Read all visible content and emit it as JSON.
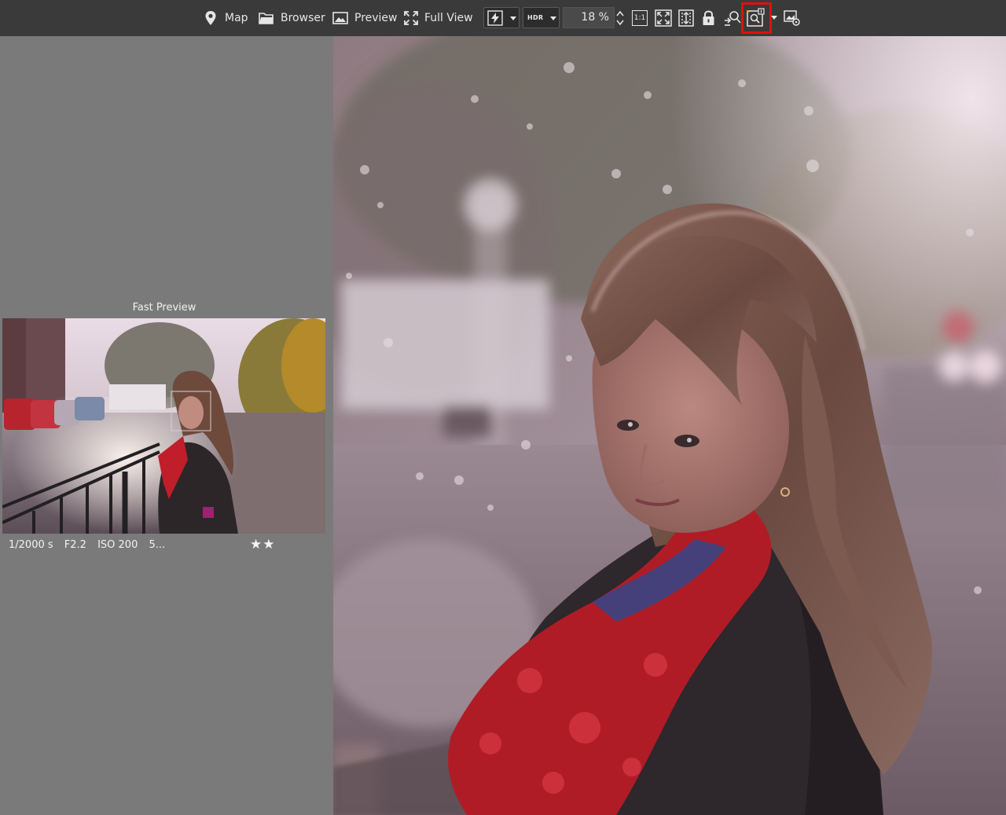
{
  "toolbar": {
    "map_label": "Map",
    "browser_label": "Browser",
    "preview_label": "Preview",
    "fullview_label": "Full View",
    "hdr_label": "HDR",
    "zoom_value": "18 %",
    "one_to_one_label": "1:1"
  },
  "left_panel": {
    "title": "Fast Preview",
    "exif": {
      "shutter": "1/2000 s",
      "aperture": "F2.2",
      "iso": "ISO 200",
      "more": "5..."
    },
    "rating_stars": "★★"
  },
  "colors": {
    "toolbar_bg": "#3a3a3a",
    "panel_bg": "#7a7a7a",
    "highlight": "#e01010"
  },
  "icons": [
    "map-pin-icon",
    "folder-icon",
    "image-icon",
    "fullscreen-icon",
    "flash-icon",
    "zoom-fit-icon",
    "fit-height-icon",
    "lock-icon",
    "zoom-tool-icon",
    "fast-preview-icon",
    "image-settings-icon"
  ]
}
